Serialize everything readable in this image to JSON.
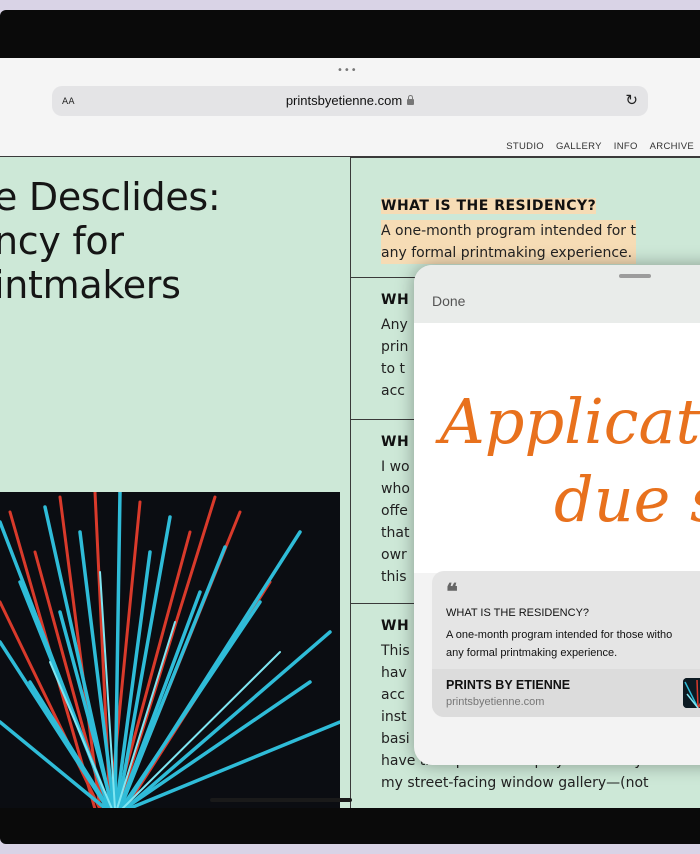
{
  "browser": {
    "text_size_button": "AA",
    "url": "printsbyetienne.com",
    "reload_label": "↻",
    "multitask_dots": "•••"
  },
  "site_nav": [
    "STUDIO",
    "GALLERY",
    "INFO",
    "ARCHIVE"
  ],
  "hero": {
    "line1": "e Desclides:",
    "line2": "ncy for",
    "line3": "intmakers"
  },
  "faq": [
    {
      "question": "WHAT IS THE RESIDENCY?",
      "answer_lines": [
        "A one-month program intended for t",
        "any formal printmaking experience."
      ]
    },
    {
      "question": "WH",
      "answer_lines": [
        "Any",
        "prin",
        "to t",
        "acc"
      ]
    },
    {
      "question": "WH",
      "answer_lines": [
        "I wo",
        "who",
        "offe",
        "that",
        "owr",
        "this"
      ]
    },
    {
      "question": "WH",
      "answer_lines": [
        "This",
        "hav",
        "acc",
        "inst",
        "basi",
        "have the option to display the work yo",
        "my street-facing window gallery—(not"
      ]
    }
  ],
  "quick_note": {
    "done_label": "Done",
    "handwriting_line1": "Applicati",
    "handwriting_line2": "due s",
    "ink_color": "#e8711d",
    "quote_mark": "❝",
    "quote_title": "WHAT IS THE RESIDENCY?",
    "quote_body_lines": [
      "A one-month program intended for those witho",
      "any formal printmaking experience."
    ],
    "link_title": "PRINTS BY ETIENNE",
    "link_url": "printsbyetienne.com"
  },
  "colors": {
    "page_bg": "#cde8d7",
    "highlight": "#f6dcb5",
    "bezel": "#0a0a0a"
  }
}
